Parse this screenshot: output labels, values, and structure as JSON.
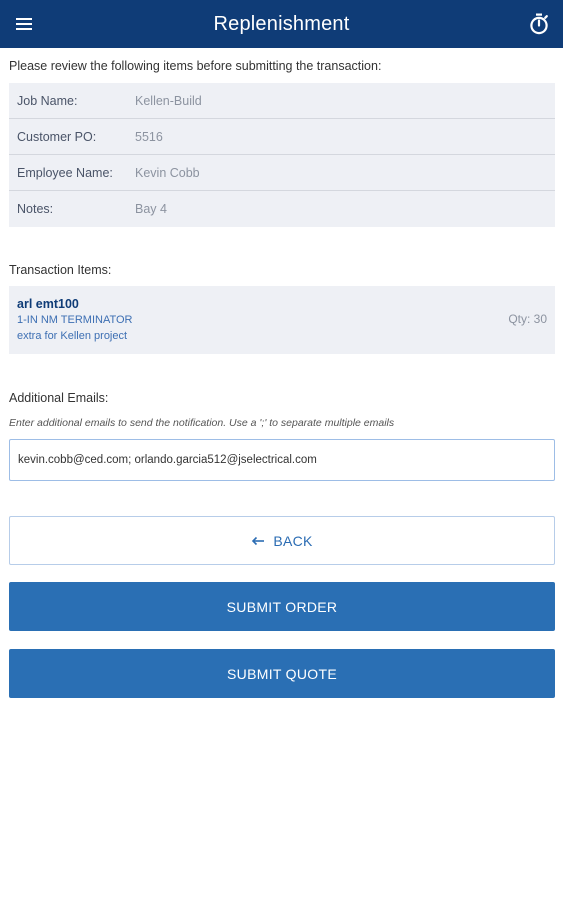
{
  "header": {
    "title": "Replenishment",
    "menu_icon": "hamburger-menu-icon",
    "timer_icon": "stopwatch-icon",
    "background": "#0f3c77"
  },
  "review": {
    "intro": "Please review the following items before submitting the transaction:",
    "rows": [
      {
        "label": "Job Name:",
        "value": "Kellen-Build"
      },
      {
        "label": "Customer PO:",
        "value": "5516"
      },
      {
        "label": "Employee Name:",
        "value": "Kevin Cobb"
      },
      {
        "label": "Notes:",
        "value": "Bay 4"
      }
    ]
  },
  "transaction": {
    "label": "Transaction Items:",
    "items": [
      {
        "sku": "arl emt100",
        "description": "1-IN NM TERMINATOR",
        "note": "extra for Kellen project",
        "qty": "Qty: 30"
      }
    ]
  },
  "emails": {
    "label": "Additional Emails:",
    "hint": "Enter additional emails to send the notification. Use a ';' to separate multiple emails",
    "value": "kevin.cobb@ced.com; orlando.garcia512@jselectrical.com"
  },
  "actions": {
    "back_label": "BACK",
    "back_icon": "arrow-left-icon",
    "submit_order_label": "SUBMIT ORDER",
    "submit_quote_label": "SUBMIT QUOTE",
    "primary_color": "#2a6fb4"
  }
}
